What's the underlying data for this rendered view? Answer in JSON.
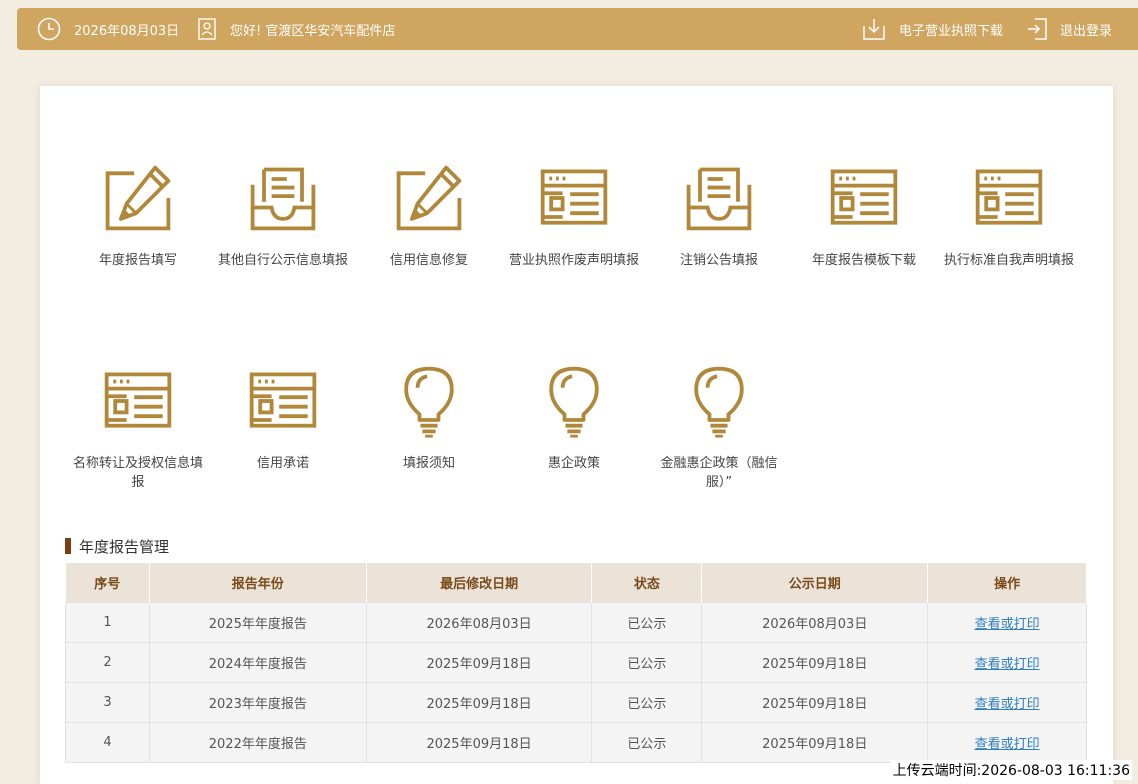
{
  "topbar": {
    "date": "2026年08月03日",
    "greeting": "您好! 官渡区华安汽车配件店",
    "license_download": "电子营业执照下载",
    "logout": "退出登录"
  },
  "colors": {
    "gold": "#b1873a",
    "bar": "#cfa55f",
    "link": "#2d7fc5"
  },
  "tiles": [
    {
      "label": "年度报告填写",
      "icon": "pencil-edit-icon"
    },
    {
      "label": "其他自行公示信息填报",
      "icon": "inbox-tray-icon"
    },
    {
      "label": "信用信息修复",
      "icon": "pencil-edit-icon"
    },
    {
      "label": "营业执照作废声明填报",
      "icon": "form-window-icon"
    },
    {
      "label": "注销公告填报",
      "icon": "inbox-tray-icon"
    },
    {
      "label": "年度报告模板下载",
      "icon": "form-window-icon"
    },
    {
      "label": "执行标准自我声明填报",
      "icon": "form-window-icon"
    },
    {
      "label": "名称转让及授权信息填报",
      "icon": "form-window-icon"
    },
    {
      "label": "信用承诺",
      "icon": "form-window-icon"
    },
    {
      "label": "填报须知",
      "icon": "lightbulb-icon"
    },
    {
      "label": "惠企政策",
      "icon": "lightbulb-icon"
    },
    {
      "label": "金融惠企政策（融信服）”",
      "icon": "lightbulb-icon"
    }
  ],
  "section": {
    "title": "年度报告管理"
  },
  "table": {
    "headers": [
      "序号",
      "报告年份",
      "最后修改日期",
      "状态",
      "公示日期",
      "操作"
    ],
    "rows": [
      [
        "1",
        "2025年年度报告",
        "2026年08月03日",
        "已公示",
        "2026年08月03日",
        "查看或打印"
      ],
      [
        "2",
        "2024年年度报告",
        "2025年09月18日",
        "已公示",
        "2025年09月18日",
        "查看或打印"
      ],
      [
        "3",
        "2023年年度报告",
        "2025年09月18日",
        "已公示",
        "2025年09月18日",
        "查看或打印"
      ],
      [
        "4",
        "2022年年度报告",
        "2025年09月18日",
        "已公示",
        "2025年09月18日",
        "查看或打印"
      ]
    ]
  },
  "upload_time": "上传云端时间:2026-08-03 16:11:36"
}
